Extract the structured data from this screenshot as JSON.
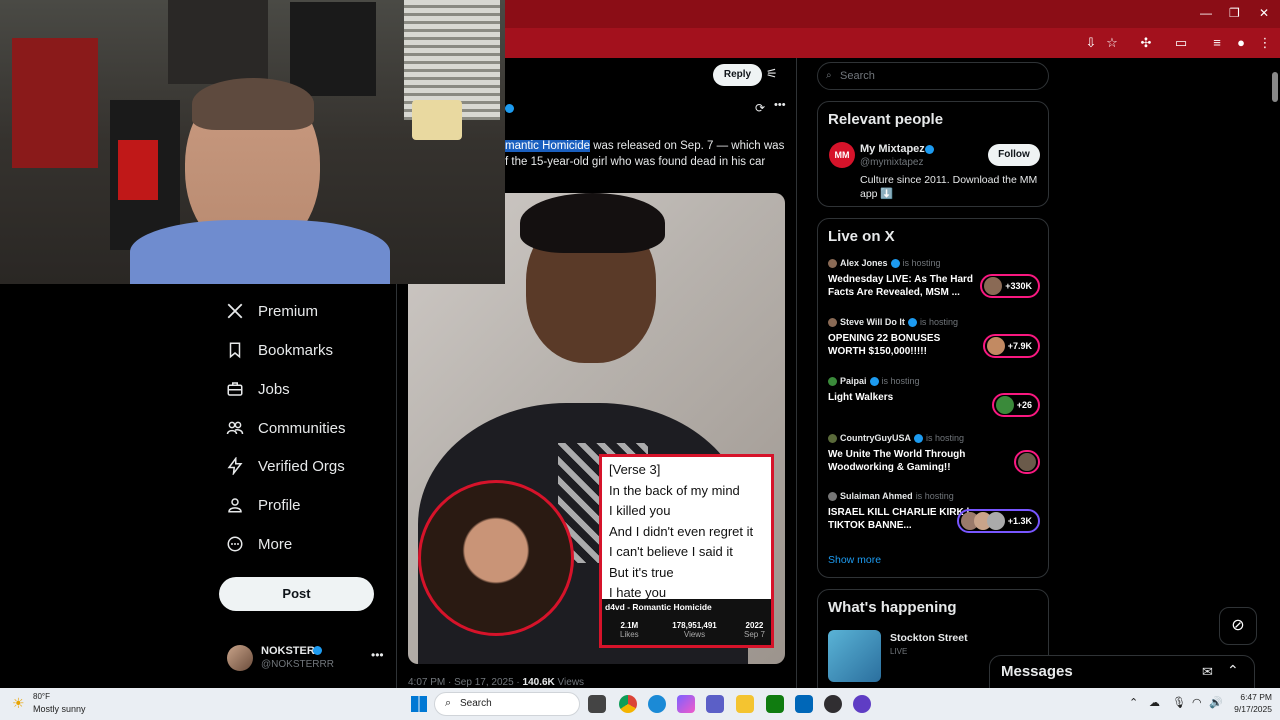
{
  "browser": {
    "window_controls": [
      "—",
      "❐",
      "✕"
    ]
  },
  "tweet": {
    "reply_label": "Reply",
    "text_line1_highlight": "mantic Homicide",
    "text_line1_rest": " was released on Sep. 7 — which was",
    "text_line2": "f the 15-year-old girl who was found dead in his car",
    "meta_time": "4:07 PM · Sep 17, 2025 · ",
    "meta_views_count": "140.6K",
    "meta_views_label": " Views",
    "lyrics": {
      "lines": [
        "[Verse 3]",
        "In the back of my mind",
        "I killed you",
        "And I didn't even regret it",
        "I can't believe I said it",
        "But it's true",
        "I hate you"
      ],
      "song": "d4vd - Romantic Homicide",
      "stats": [
        {
          "value": "2.1M",
          "label": "Likes"
        },
        {
          "value": "178,951,491",
          "label": "Views"
        },
        {
          "value": "2022",
          "label": "Sep 7"
        }
      ]
    }
  },
  "nav": {
    "items": [
      {
        "label": "Premium",
        "icon": "x-logo-icon"
      },
      {
        "label": "Bookmarks",
        "icon": "bookmark-icon"
      },
      {
        "label": "Jobs",
        "icon": "briefcase-icon"
      },
      {
        "label": "Communities",
        "icon": "people-icon"
      },
      {
        "label": "Verified Orgs",
        "icon": "lightning-icon"
      },
      {
        "label": "Profile",
        "icon": "person-icon"
      },
      {
        "label": "More",
        "icon": "more-circle-icon"
      }
    ],
    "post_label": "Post",
    "account": {
      "name": "NOKSTER",
      "handle": "@NOKSTERRR"
    }
  },
  "sidebar": {
    "search_placeholder": "Search",
    "relevant": {
      "title": "Relevant people",
      "name": "My Mixtapez",
      "handle": "@mymixtapez",
      "follow_label": "Follow",
      "bio": "Culture since 2011. Download the MM app ⬇️"
    },
    "live": {
      "title": "Live on X",
      "hosting_label": "is hosting",
      "items": [
        {
          "host": "Alex Jones",
          "title": "Wednesday LIVE: As The Hard Facts Are Revealed, MSM ...",
          "count": "+330K"
        },
        {
          "host": "Steve Will Do It",
          "title": "OPENING 22 BONUSES WORTH $150,000!!!!!",
          "count": "+7.9K"
        },
        {
          "host": "Paipai",
          "title": "Light Walkers",
          "count": "+26"
        },
        {
          "host": "CountryGuyUSA",
          "title": "We Unite The World Through Woodworking & Gaming!!",
          "count": ""
        },
        {
          "host": "Sulaiman Ahmed",
          "title": "ISRAEL KILL CHARLIE KIRK | TIKTOK BANNE...",
          "count": "+1.3K"
        }
      ],
      "show_more": "Show more"
    },
    "happening": {
      "title": "What's happening",
      "item_title": "Stockton Street",
      "item_sub": "LIVE"
    },
    "messages_label": "Messages"
  },
  "taskbar": {
    "weather_temp": "80°F",
    "weather_desc": "Mostly sunny",
    "search_label": "Search",
    "time": "6:47 PM",
    "date": "9/17/2025"
  }
}
